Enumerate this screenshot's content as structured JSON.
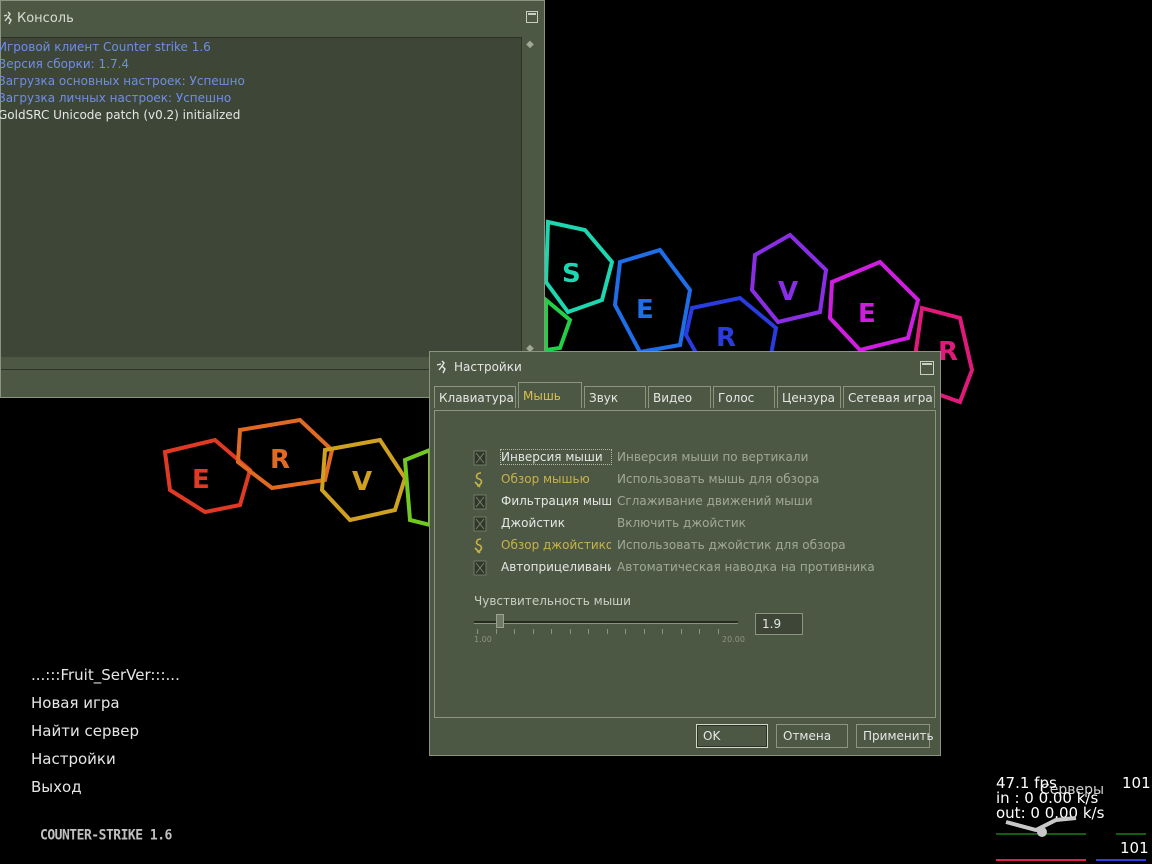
{
  "console": {
    "title": "Консоль",
    "lines": [
      {
        "text": "Игровой клиент Counter strike 1.6",
        "color": "blue"
      },
      {
        "text": "Версия сборки: 1.7.4",
        "color": "blue"
      },
      {
        "text": "Загрузка основных настроек: Успешно",
        "color": "blue"
      },
      {
        "text": "Загрузка личных настроек: Успешно",
        "color": "blue"
      },
      {
        "text": "GoldSRC Unicode patch (v0.2) initialized",
        "color": "white"
      }
    ]
  },
  "main_menu": {
    "server_name": "...:::Fruit_SerVer:::...",
    "items": [
      "Новая игра",
      "Найти сервер",
      "Настройки",
      "Выход"
    ],
    "logo_text": "COUNTER-STRIKE 1.6"
  },
  "settings": {
    "title": "Настройки",
    "tabs": [
      "Клавиатура",
      "Мышь",
      "Звук",
      "Видео",
      "Голос",
      "Цензура",
      "Сетевая игра"
    ],
    "active_tab": "Мышь",
    "options": [
      {
        "label": "Инверсия мыши",
        "desc": "Инверсия мыши по вертикали",
        "checked": false,
        "gold": false
      },
      {
        "label": "Обзор мышью",
        "desc": "Использовать мышь для обзора",
        "checked": true,
        "gold": true
      },
      {
        "label": "Фильтрация мыши",
        "desc": "Сглаживание движений мыши",
        "checked": false,
        "gold": false
      },
      {
        "label": "Джойстик",
        "desc": "Включить джойстик",
        "checked": false,
        "gold": false
      },
      {
        "label": "Обзор джойстиком",
        "desc": "Использовать джойстик для обзора",
        "checked": true,
        "gold": true
      },
      {
        "label": "Автоприцеливание",
        "desc": "Автоматическая наводка на противника",
        "checked": false,
        "gold": false
      }
    ],
    "sensitivity": {
      "label": "Чувствительность мыши",
      "value": "1.9",
      "min": 1.0,
      "max": 20.0,
      "min_label": "1.00",
      "max_label": "20.00"
    },
    "buttons": {
      "ok": "OK",
      "cancel": "Отмена",
      "apply": "Применить"
    }
  },
  "netgraph": {
    "fps": "47.1 fps",
    "fps_right": "101",
    "in": "in :  0 0.00 k/s",
    "out": "out:  0 0.00 k/s",
    "overlay": "Серверы",
    "bottom_right": "101"
  },
  "colors": {
    "panel": "#4c5844",
    "panel_dark": "#3e4737",
    "gold": "#c8b24a",
    "blue_text": "#6f8de6"
  }
}
